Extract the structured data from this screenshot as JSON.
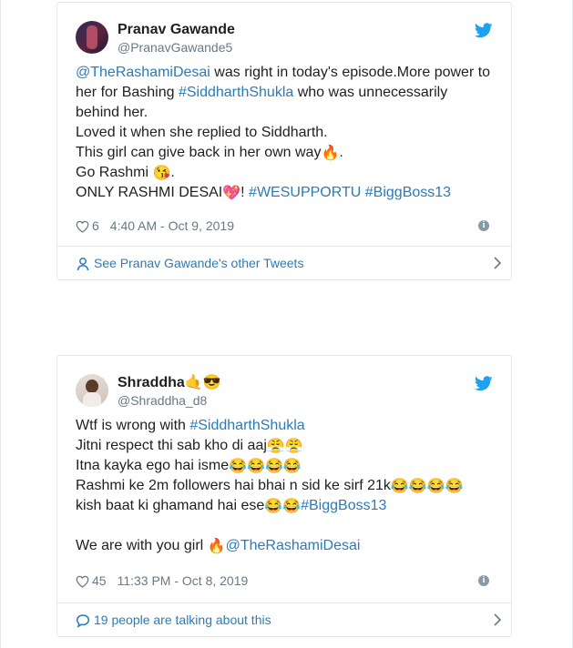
{
  "tweets": [
    {
      "display_name": "Pranav Gawande",
      "name_emoji": "",
      "handle": "@PranavGawande5",
      "lines": [
        {
          "parts": [
            {
              "t": "@TheRashamiDesai",
              "link": true
            },
            {
              "t": " was right in today's episode.More power to"
            }
          ]
        },
        {
          "parts": [
            {
              "t": "her for Bashing "
            },
            {
              "t": "#SiddharthShukla",
              "link": true
            },
            {
              "t": " who was unnecessarily"
            }
          ]
        },
        {
          "parts": [
            {
              "t": "behind her."
            }
          ]
        },
        {
          "parts": [
            {
              "t": "Loved it when she replied to Siddharth."
            }
          ]
        },
        {
          "parts": [
            {
              "t": "This girl can give back in her own way"
            },
            {
              "t": "🔥",
              "emoji": true
            },
            {
              "t": "."
            }
          ]
        },
        {
          "parts": [
            {
              "t": "Go Rashmi "
            },
            {
              "t": "😘",
              "emoji": true
            },
            {
              "t": "."
            }
          ]
        },
        {
          "parts": [
            {
              "t": "ONLY RASHMI DESAI"
            },
            {
              "t": "💖",
              "emoji": true
            },
            {
              "t": "! "
            },
            {
              "t": "#WESUPPORTU",
              "link": true
            },
            {
              "t": " "
            },
            {
              "t": "#BiggBoss13",
              "link": true
            }
          ]
        }
      ],
      "likes": "6",
      "timestamp": "4:40 AM - Oct 9, 2019",
      "footer_text": "See Pranav Gawande's other Tweets",
      "footer_icon": "person-icon"
    },
    {
      "display_name": "Shraddha",
      "name_emoji": "🤙😎",
      "handle": "@Shraddha_d8",
      "lines": [
        {
          "parts": [
            {
              "t": "Wtf is wrong with "
            },
            {
              "t": "#SiddharthShukla",
              "link": true
            }
          ]
        },
        {
          "parts": [
            {
              "t": "Jitni respect thi sab kho di aaj"
            },
            {
              "t": "😤😤",
              "emoji": true
            }
          ]
        },
        {
          "parts": [
            {
              "t": "Itna kayka ego hai isme"
            },
            {
              "t": "😂😂😂😂",
              "emoji": true
            }
          ]
        },
        {
          "parts": [
            {
              "t": "Rashmi ke 2m followers hai bhai n sid ke sirf 21k"
            },
            {
              "t": "😂😂😂😂",
              "emoji": true
            }
          ]
        },
        {
          "parts": [
            {
              "t": "kish baat ki ghamand hai ese"
            },
            {
              "t": "😂😂",
              "emoji": true
            },
            {
              "t": "#BiggBoss13",
              "link": true
            }
          ]
        },
        {
          "blank": true
        },
        {
          "parts": [
            {
              "t": "We are with you girl "
            },
            {
              "t": "🔥",
              "emoji": true
            },
            {
              "t": "@TheRashamiDesai",
              "link": true
            }
          ]
        }
      ],
      "likes": "45",
      "timestamp": "11:33 PM - Oct 8, 2019",
      "footer_text": "19 people are talking about this",
      "footer_icon": "speech-bubble-icon"
    }
  ],
  "colors": {
    "link": "#2b7bb9",
    "meta": "#697882",
    "border": "#e1e8ed",
    "twitter_blue": "#1da1f2"
  },
  "icons": {
    "brand": "twitter-bird-icon",
    "like": "heart-icon",
    "info": "info-icon",
    "chevron": "chevron-right-icon"
  }
}
